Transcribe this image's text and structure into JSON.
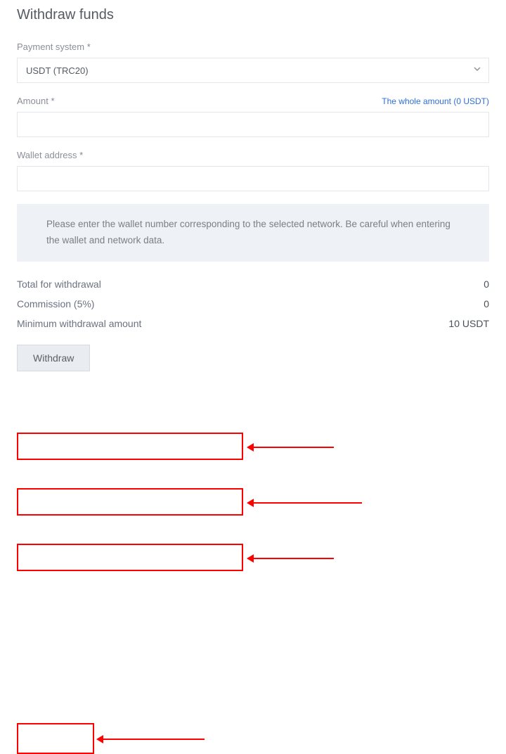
{
  "title": "Withdraw funds",
  "fields": {
    "payment_system": {
      "label": "Payment system",
      "required_mark": "*",
      "selected": "USDT (TRC20)"
    },
    "amount": {
      "label": "Amount",
      "required_mark": "*",
      "whole_link": "The whole amount (0 USDT)",
      "value": ""
    },
    "wallet": {
      "label": "Wallet address",
      "required_mark": "*",
      "value": ""
    }
  },
  "notice": "Please enter the wallet number corresponding to the selected network. Be careful when entering the wallet and network data.",
  "summary": {
    "total_label": "Total for withdrawal",
    "total_value": "0",
    "commission_label": "Commission (5%)",
    "commission_value": "0",
    "minimum_label": "Minimum withdrawal amount",
    "minimum_value": "10 USDT"
  },
  "withdraw_button": "Withdraw"
}
